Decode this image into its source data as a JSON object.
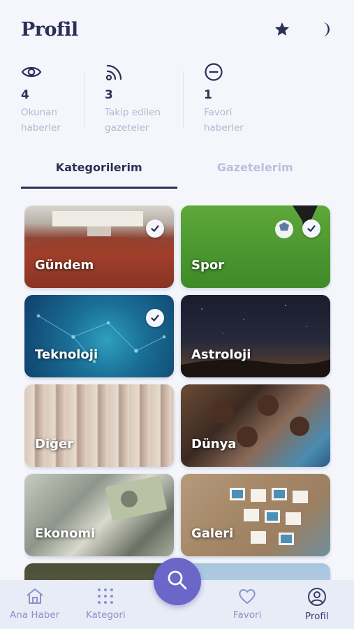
{
  "header": {
    "title": "Profil",
    "icons": [
      "star-icon",
      "moon-icon"
    ]
  },
  "stats": [
    {
      "icon": "eye-icon",
      "count": "4",
      "line1": "Okunan",
      "line2": "haberler"
    },
    {
      "icon": "rss-icon",
      "count": "3",
      "line1": "Takip edilen",
      "line2": "gazeteler"
    },
    {
      "icon": "minus-circle-icon",
      "count": "1",
      "line1": "Favori",
      "line2": "haberler"
    }
  ],
  "tabs": [
    {
      "label": "Kategorilerim",
      "active": true
    },
    {
      "label": "Gazetelerim",
      "active": false
    }
  ],
  "categories": [
    {
      "label": "Gündem",
      "checked": true
    },
    {
      "label": "Spor",
      "checked": true
    },
    {
      "label": "Teknoloji",
      "checked": true
    },
    {
      "label": "Astroloji",
      "checked": false
    },
    {
      "label": "Diğer",
      "checked": false
    },
    {
      "label": "Dünya",
      "checked": false
    },
    {
      "label": "Ekonomi",
      "checked": false
    },
    {
      "label": "Galeri",
      "checked": false
    }
  ],
  "nav": {
    "items": [
      {
        "label": "Ana Haber",
        "icon": "home-icon"
      },
      {
        "label": "Kategori",
        "icon": "grid-dots-icon"
      },
      {
        "label": "Favori",
        "icon": "heart-icon"
      },
      {
        "label": "Profil",
        "icon": "user-circle-icon",
        "active": true
      }
    ],
    "fab_icon": "search-icon"
  },
  "colors": {
    "primary": "#2c2f57",
    "accent": "#6a67c9",
    "muted": "#b2b8cf",
    "background": "#f4f6fb"
  }
}
